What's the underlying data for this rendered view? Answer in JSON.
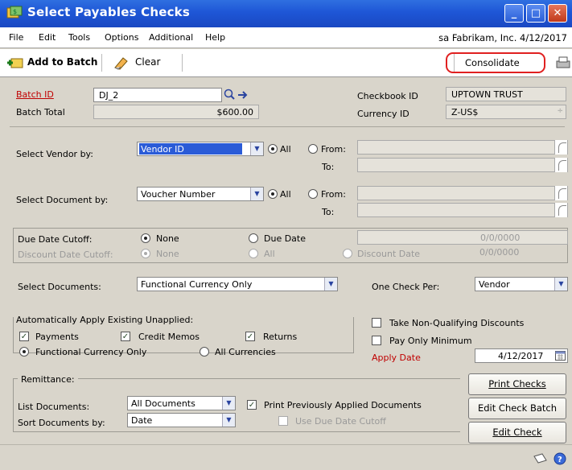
{
  "window": {
    "title": "Select Payables Checks"
  },
  "menu": {
    "items": [
      "File",
      "Edit",
      "Tools",
      "Options",
      "Additional",
      "Help"
    ],
    "user": "sa  Fabrikam, Inc.  4/12/2017"
  },
  "toolbar": {
    "add_to_batch": "Add to Batch",
    "clear": "Clear",
    "consolidate": "Consolidate"
  },
  "batch": {
    "id_label": "Batch ID",
    "id_value": "DJ_2",
    "total_label": "Batch Total",
    "total_value": "$600.00"
  },
  "checkbook": {
    "label": "Checkbook ID",
    "value": "UPTOWN TRUST",
    "currency_label": "Currency ID",
    "currency_value": "Z-US$"
  },
  "vendor": {
    "label": "Select Vendor by:",
    "value": "Vendor ID",
    "all": "All",
    "from": "From:",
    "to": "To:"
  },
  "document": {
    "label": "Select Document by:",
    "value": "Voucher Number",
    "all": "All",
    "from": "From:",
    "to": "To:"
  },
  "cutoff": {
    "due_label": "Due Date Cutoff:",
    "due_none": "None",
    "due_date": "Due Date",
    "due_value": "0/0/0000",
    "discount_label": "Discount Date Cutoff:",
    "discount_none": "None",
    "discount_all": "All",
    "discount_date": "Discount Date",
    "discount_value": "0/0/0000"
  },
  "select_docs": {
    "label": "Select Documents:",
    "value": "Functional Currency Only",
    "one_check_label": "One Check Per:",
    "one_check_value": "Vendor"
  },
  "auto_apply": {
    "label": "Automatically Apply Existing Unapplied:",
    "payments": "Payments",
    "credit_memos": "Credit Memos",
    "returns": "Returns",
    "functional": "Functional Currency Only",
    "all_currencies": "All Currencies"
  },
  "options": {
    "take_non_qualifying": "Take Non-Qualifying Discounts",
    "pay_only_minimum": "Pay Only Minimum",
    "apply_date_label": "Apply Date",
    "apply_date_value": "4/12/2017"
  },
  "remittance": {
    "label": "Remittance:",
    "list_docs_label": "List Documents:",
    "list_docs_value": "All Documents",
    "sort_label": "Sort Documents by:",
    "sort_value": "Date",
    "print_prev": "Print Previously Applied Documents",
    "use_due": "Use Due Date Cutoff"
  },
  "buttons": {
    "print_checks": "Print Checks",
    "edit_batch": "Edit Check Batch",
    "edit_check": "Edit Check"
  },
  "colors": {
    "title_bar": "#1e56d6",
    "required_label": "#c00000",
    "highlight": "#2a5bd7",
    "consolidate_circle": "#e02020"
  }
}
